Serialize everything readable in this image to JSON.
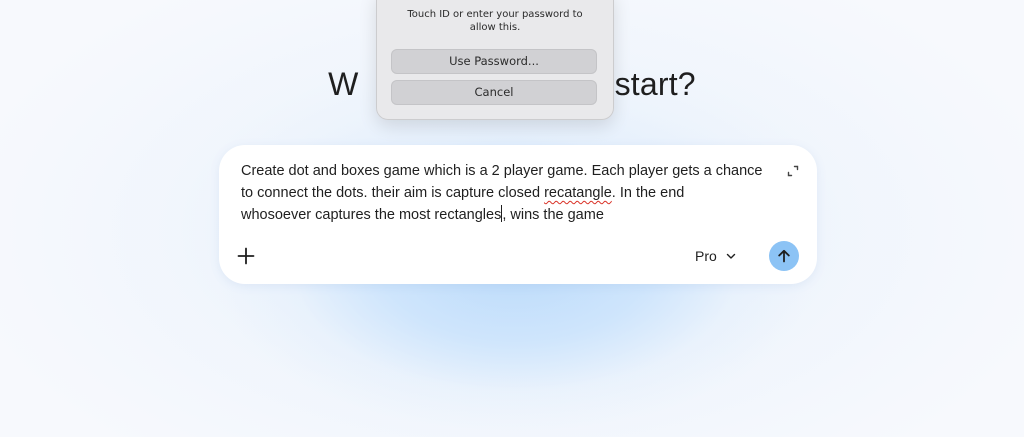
{
  "heading": {
    "left_part": "W",
    "right_part": "start?"
  },
  "auth_dialog": {
    "message": "Touch ID or enter your password to allow this.",
    "use_password_label": "Use Password...",
    "cancel_label": "Cancel"
  },
  "prompt": {
    "lines": [
      "Create dot and boxes game which is a 2 player game. Each player gets a chance",
      "to connect the dots. their aim is capture closed",
      "recatangle",
      ". In the end",
      "whosoever captures the most rectangles",
      ", wins the game"
    ],
    "model_label": "Pro",
    "icons": {
      "expand": "expand-icon",
      "add": "plus-icon",
      "model_dropdown": "chevron-down-icon",
      "send": "arrow-up-icon"
    }
  },
  "colors": {
    "send_button": "#8cc3f5",
    "misspell_underline": "#d93025"
  }
}
